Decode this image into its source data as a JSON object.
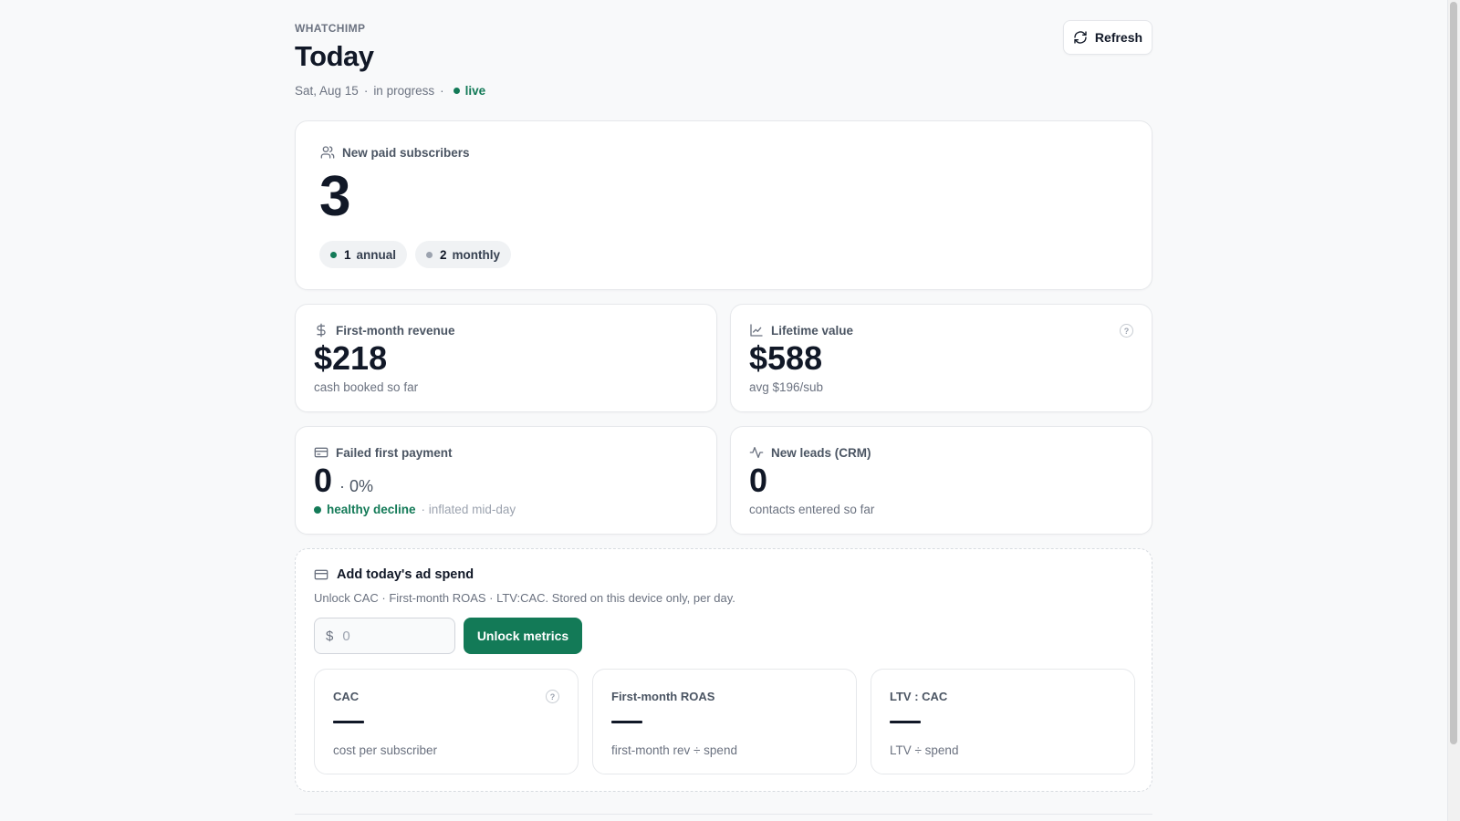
{
  "header": {
    "brand": "WHATCHIMP",
    "title": "Today",
    "date": "Sat, Aug 15",
    "status": "in progress",
    "separator": "·",
    "live_label": "live",
    "refresh_label": "Refresh"
  },
  "hero": {
    "label": "New paid subscribers",
    "value": "3",
    "pills": [
      {
        "count": "1",
        "label": "annual",
        "dot_color": "#137a57"
      },
      {
        "count": "2",
        "label": "monthly",
        "dot_color": "#9ca3af"
      }
    ]
  },
  "metrics": {
    "revenue": {
      "label": "First-month revenue",
      "value": "$218",
      "sub": "cash booked so far"
    },
    "ltv": {
      "label": "Lifetime value",
      "value": "$588",
      "sub": "avg $196/sub",
      "help": "?"
    },
    "failed": {
      "label": "Failed first payment",
      "value": "0",
      "suffix": "· 0%",
      "status": "healthy decline",
      "note": "· inflated mid-day"
    },
    "leads": {
      "label": "New leads (CRM)",
      "value": "0",
      "sub": "contacts entered so far"
    }
  },
  "spend": {
    "title": "Add today's ad spend",
    "description": "Unlock CAC · First-month ROAS · LTV:CAC. Stored on this device only, per day.",
    "currency": "$",
    "input_value": "",
    "input_placeholder": "0",
    "unlock_label": "Unlock metrics",
    "kpis": [
      {
        "label": "CAC",
        "value": "",
        "sub": "cost per subscriber",
        "help": "?"
      },
      {
        "label": "First-month ROAS",
        "value": "",
        "sub": "first-month rev ÷ spend"
      },
      {
        "label": "LTV : CAC",
        "value": "",
        "sub": "LTV ÷ spend"
      }
    ]
  },
  "colors": {
    "accent": "#137a57",
    "muted_dot": "#9ca3af",
    "background": "#f8f9fa"
  },
  "icons": {
    "hero": "users-icon",
    "revenue": "dollar-icon",
    "ltv": "line-chart-icon",
    "failed": "credit-card-icon",
    "leads": "activity-icon",
    "spend": "wallet-card-icon",
    "refresh": "refresh-icon"
  }
}
